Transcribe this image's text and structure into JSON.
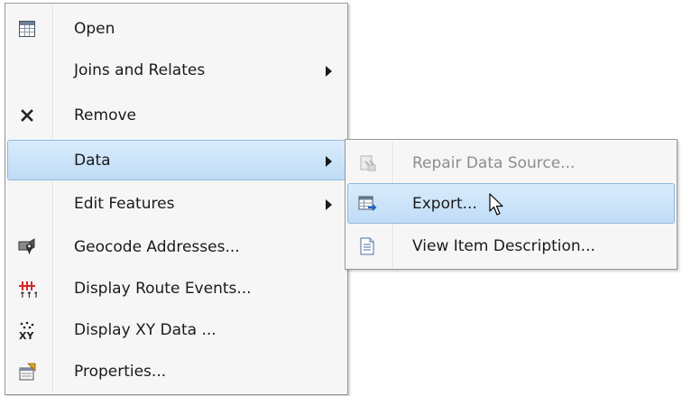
{
  "context_menu": {
    "items": [
      {
        "label": "Open",
        "icon": "table-icon"
      },
      {
        "label": "Joins and Relates",
        "submenu": true
      },
      {
        "label": "Remove",
        "icon": "close-icon"
      },
      {
        "label": "Data",
        "submenu": true,
        "highlighted": true
      },
      {
        "label": "Edit Features",
        "submenu": true
      },
      {
        "label": "Geocode Addresses...",
        "icon": "geocode-icon"
      },
      {
        "label": "Display Route Events...",
        "icon": "route-events-icon"
      },
      {
        "label": "Display XY Data ...",
        "icon": "xy-data-icon"
      },
      {
        "label": "Properties...",
        "icon": "properties-icon"
      }
    ]
  },
  "data_submenu": {
    "items": [
      {
        "label": "Repair Data Source...",
        "icon": "repair-data-source-icon",
        "disabled": true
      },
      {
        "label": "Export...",
        "icon": "export-icon",
        "highlighted": true
      },
      {
        "label": "View Item Description...",
        "icon": "item-description-icon"
      }
    ]
  },
  "colors": {
    "highlight": "#bfdcf6",
    "highlight_border": "#8fb8df",
    "menu_background": "#f6f6f6",
    "disabled_text": "#8d8d8d"
  }
}
